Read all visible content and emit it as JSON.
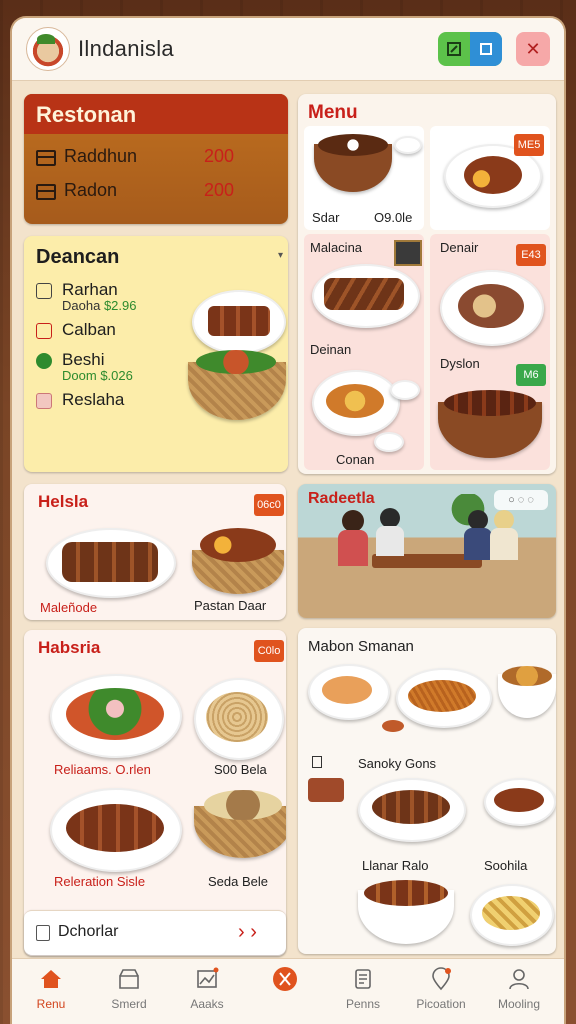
{
  "app": {
    "title": "Ilndanisla"
  },
  "header": {
    "edit_icon": "edit-icon",
    "share_icon": "share-icon",
    "close_icon": "close-icon",
    "close_glyph": "✕"
  },
  "restoran": {
    "title": "Restonan",
    "rows": [
      {
        "label": "Raddhun",
        "value": "200"
      },
      {
        "label": "Radon",
        "value": "200"
      }
    ]
  },
  "deancan": {
    "title": "Deancan",
    "items": [
      {
        "label": "Rarhan",
        "sub_label": "Daoha",
        "sub_value": "$2.96"
      },
      {
        "label": "Calban"
      },
      {
        "label": "Beshi",
        "sub_label": "Doom",
        "sub_value": "$.026"
      },
      {
        "label": "Reslaha"
      }
    ]
  },
  "menu": {
    "title": "Menu",
    "cells": [
      {
        "label": "Sdar",
        "label2": "O9.0le"
      },
      {
        "label": "",
        "badge": "ME5"
      },
      {
        "label": "Malacina",
        "label2": "Deinan"
      },
      {
        "label": "Denair",
        "badge": "E43"
      },
      {
        "label": "Dyslon",
        "badge": "M6"
      },
      {
        "label": "Conan"
      }
    ]
  },
  "helsla": {
    "title": "Helsla",
    "badge": "06c0",
    "items": [
      {
        "label": "Maleñode"
      },
      {
        "label": "Pastan Daar"
      }
    ]
  },
  "hebsria": {
    "title": "Habsria",
    "badge": "C0lo",
    "items": [
      {
        "label": "Reliaams. O.rlen"
      },
      {
        "label": "S00 Bela"
      },
      {
        "label": "Releration Sisle"
      },
      {
        "label": "Seda Bele"
      }
    ]
  },
  "dchorlar": {
    "label": "Dchorlar",
    "arrow": "›  ›"
  },
  "photo": {
    "title": "Radeetla",
    "tools": "○ ◌ ◌"
  },
  "maban": {
    "title": "Mabon Smanan",
    "labels": [
      "Sanoky Gons",
      "Llanar Ralo",
      "Soohila"
    ]
  },
  "nav": {
    "items": [
      {
        "label": "Renu",
        "icon": "home-icon",
        "active": true
      },
      {
        "label": "Smerd",
        "icon": "store-icon",
        "active": false
      },
      {
        "label": "Aaaks",
        "icon": "image-icon",
        "active": false
      },
      {
        "label": "",
        "icon": "utensils-icon",
        "active": false
      },
      {
        "label": "Penns",
        "icon": "document-icon",
        "active": false
      },
      {
        "label": "Picoation",
        "icon": "location-icon",
        "active": false
      },
      {
        "label": "Mooling",
        "icon": "profile-icon",
        "active": false
      }
    ]
  },
  "colors": {
    "accent": "#d2451e",
    "brand_red": "#c8201a",
    "green": "#5cc24a"
  }
}
